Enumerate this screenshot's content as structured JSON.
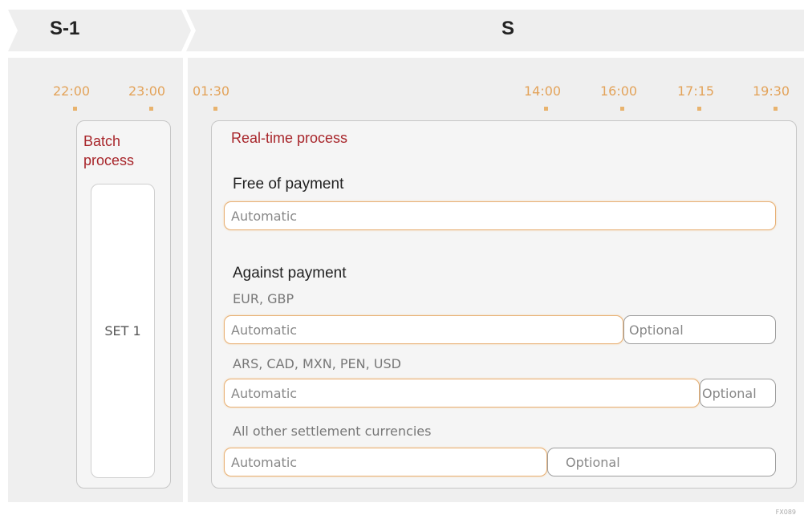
{
  "header": {
    "prev_day": "S-1",
    "current_day": "S"
  },
  "times": [
    "22:00",
    "23:00",
    "01:30",
    "14:00",
    "16:00",
    "17:15",
    "19:30"
  ],
  "batch": {
    "title_line1": "Batch",
    "title_line2": "process",
    "set_label": "SET 1"
  },
  "realtime": {
    "title": "Real-time process",
    "free_of_payment": {
      "heading": "Free of payment",
      "auto": "Automatic"
    },
    "against_payment": {
      "heading": "Against payment",
      "groups": [
        {
          "currencies": "EUR, GBP",
          "auto": "Automatic",
          "optional": "Optional"
        },
        {
          "currencies": "ARS, CAD, MXN, PEN, USD",
          "auto": "Automatic",
          "optional": "Optional"
        },
        {
          "currencies": "All other settlement currencies",
          "auto": "Automatic",
          "optional": "Optional"
        }
      ]
    }
  },
  "figure_code": "FX089",
  "colors": {
    "accent_orange": "#e3a35a",
    "title_red": "#a8262b",
    "panel_gray": "#efefef"
  }
}
